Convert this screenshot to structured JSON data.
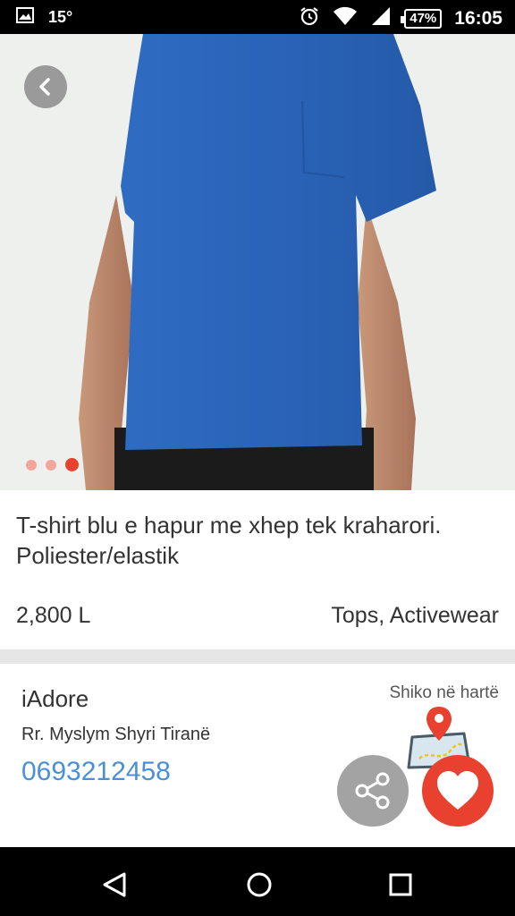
{
  "status_bar": {
    "temperature": "15°",
    "battery": "47%",
    "time": "16:05",
    "icons": [
      "image-icon",
      "alarm-icon",
      "wifi-icon",
      "signal-icon",
      "battery-icon"
    ]
  },
  "product": {
    "image_carousel": {
      "total": 3,
      "active_index": 3
    },
    "description": "T-shirt blu e hapur me xhep tek kraharori. Poliester/elastik",
    "price": "2,800 L",
    "category": "Tops, Activewear"
  },
  "store": {
    "name": "iAdore",
    "address": "Rr. Myslym Shyri Tiranë",
    "phone": "0693212458",
    "map_link_label": "Shiko në hartë"
  },
  "colors": {
    "accent_red": "#e8412f",
    "link_blue": "#4a90d9",
    "shirt_blue": "#2a63b8"
  }
}
